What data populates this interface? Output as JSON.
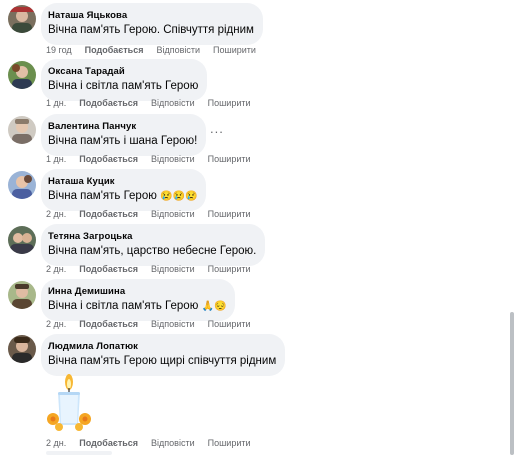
{
  "comments": [
    {
      "author": "Наташа Яцькова",
      "text": "Вічна пам'ять Герою. Співчуття рідним",
      "time": "19 год",
      "like": "Подобається",
      "reply": "Відповісти",
      "share": "Поширити"
    },
    {
      "author": "Оксана Тарадай",
      "text": "Вічна і світла пам'ять Герою",
      "time": "1 дн.",
      "like": "Подобається",
      "reply": "Відповісти",
      "share": "Поширити"
    },
    {
      "author": "Валентина Панчук",
      "text": "Вічна пам'ять і шана Герою!",
      "time": "1 дн.",
      "like": "Подобається",
      "reply": "Відповісти",
      "share": "Поширити",
      "more": "..."
    },
    {
      "author": "Наташа Куцик",
      "text": "Вічна пам'ять Герою",
      "emoji": "😢😢😢",
      "time": "2 дн.",
      "like": "Подобається",
      "reply": "Відповісти",
      "share": "Поширити"
    },
    {
      "author": "Тетяна Загроцька",
      "text": "Вічна пам'ять, царство небесне Герою.",
      "time": "2 дн.",
      "like": "Подобається",
      "reply": "Відповісти",
      "share": "Поширити"
    },
    {
      "author": "Инна Демишина",
      "text": "Вічна і світла пам'ять Герою",
      "emoji": "🙏😔",
      "time": "2 дн.",
      "like": "Подобається",
      "reply": "Відповісти",
      "share": "Поширити"
    },
    {
      "author": "Людмила Лопатюк",
      "text": "Вічна пам'ять Герою щирі співчуття рідним",
      "time": "2 дн.",
      "like": "Подобається",
      "reply": "Відповісти",
      "share": "Поширити"
    }
  ],
  "icons": {
    "more": "more-dots-icon",
    "sticker": "candle-sticker-icon"
  },
  "colors": {
    "bubble": "#f0f2f5",
    "meta": "#65676b",
    "text": "#050505"
  }
}
